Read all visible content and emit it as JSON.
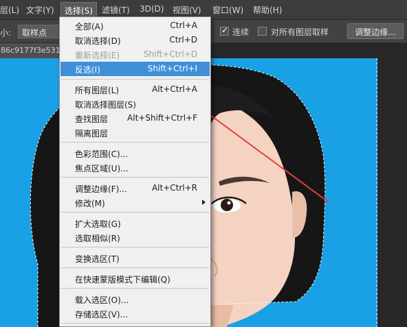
{
  "menubar": {
    "items": [
      {
        "label": "层(L)"
      },
      {
        "label": "文字(Y)"
      },
      {
        "label": "选择(S)"
      },
      {
        "label": "滤镜(T)"
      },
      {
        "label": "3D(D)"
      },
      {
        "label": "视图(V)"
      },
      {
        "label": "窗口(W)"
      },
      {
        "label": "帮助(H)"
      }
    ]
  },
  "options": {
    "size_label": "小:",
    "size_value": "取样点",
    "contiguous_label": "连续",
    "contiguous_checked": true,
    "all_layers_label": "对所有图层取样",
    "all_layers_checked": false,
    "refine_button": "调整边缘..."
  },
  "document": {
    "tab_name": "86c9177f3e531"
  },
  "select_menu": {
    "items": [
      {
        "label": "全部(A)",
        "shortcut": "Ctrl+A"
      },
      {
        "label": "取消选择(D)",
        "shortcut": "Ctrl+D"
      },
      {
        "label": "重新选择(E)",
        "shortcut": "Shift+Ctrl+D",
        "disabled": true
      },
      {
        "label": "反选(I)",
        "shortcut": "Shift+Ctrl+I",
        "highlighted": true
      },
      {
        "label": "所有图层(L)",
        "shortcut": "Alt+Ctrl+A"
      },
      {
        "label": "取消选择图层(S)",
        "shortcut": ""
      },
      {
        "label": "查找图层",
        "shortcut": "Alt+Shift+Ctrl+F"
      },
      {
        "label": "隔离图层",
        "shortcut": ""
      },
      {
        "label": "色彩范围(C)...",
        "shortcut": ""
      },
      {
        "label": "焦点区域(U)...",
        "shortcut": ""
      },
      {
        "label": "调整边缘(F)...",
        "shortcut": "Alt+Ctrl+R"
      },
      {
        "label": "修改(M)",
        "shortcut": "",
        "submenu": true
      },
      {
        "label": "扩大选取(G)",
        "shortcut": ""
      },
      {
        "label": "选取相似(R)",
        "shortcut": ""
      },
      {
        "label": "变换选区(T)",
        "shortcut": ""
      },
      {
        "label": "在快速蒙版模式下编辑(Q)",
        "shortcut": ""
      },
      {
        "label": "载入选区(O)...",
        "shortcut": ""
      },
      {
        "label": "存储选区(V)...",
        "shortcut": ""
      }
    ]
  },
  "colors": {
    "background_blue": "#1aa0e4",
    "highlight": "#3f8fd9",
    "annotation_arrow": "#e8403a"
  }
}
